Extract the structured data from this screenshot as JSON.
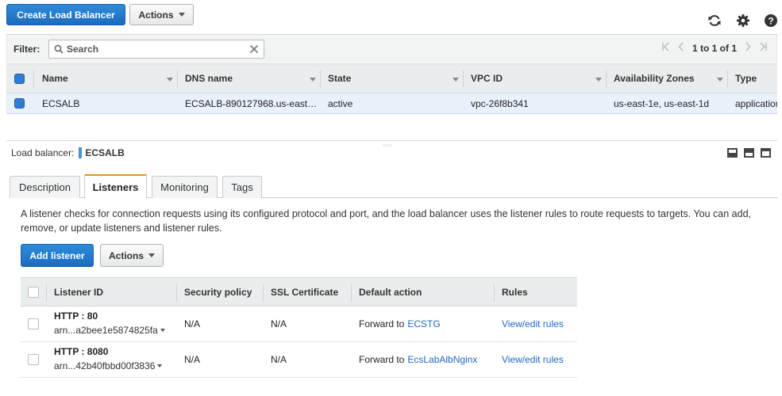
{
  "toolbar": {
    "create_button": "Create Load Balancer",
    "actions_button": "Actions",
    "icons": [
      "refresh-icon",
      "gear-icon",
      "help-icon"
    ]
  },
  "filter": {
    "label": "Filter:",
    "search_placeholder": "Search",
    "search_value": "",
    "pagination": "1 to 1 of 1"
  },
  "lb_table": {
    "columns": [
      "Name",
      "DNS name",
      "State",
      "VPC ID",
      "Availability Zones",
      "Type"
    ],
    "rows": [
      {
        "name": "ECSALB",
        "dns": "ECSALB-890127968.us-east…",
        "state": "active",
        "vpc": "vpc-26f8b341",
        "azs": "us-east-1e, us-east-1d",
        "type": "application"
      }
    ]
  },
  "details": {
    "label": "Load balancer:",
    "name": "ECSALB",
    "tabs": [
      "Description",
      "Listeners",
      "Monitoring",
      "Tags"
    ],
    "active_tab": "Listeners",
    "description": "A listener checks for connection requests using its configured protocol and port, and the load balancer uses the listener rules to route requests to targets. You can add, remove, or update listeners and listener rules.",
    "add_listener_button": "Add listener",
    "actions_button": "Actions"
  },
  "listeners": {
    "columns": [
      "Listener ID",
      "Security policy",
      "SSL Certificate",
      "Default action",
      "Rules"
    ],
    "rows": [
      {
        "protocol_port": "HTTP : 80",
        "arn": "arn...a2bee1e5874825fa",
        "security_policy": "N/A",
        "ssl_certificate": "N/A",
        "action_prefix": "Forward to",
        "target": "ECSTG",
        "rules_link": "View/edit rules"
      },
      {
        "protocol_port": "HTTP : 8080",
        "arn": "arn...42b40fbbd00f3836",
        "security_policy": "N/A",
        "ssl_certificate": "N/A",
        "action_prefix": "Forward to",
        "target": "EcsLabAlbNginx",
        "rules_link": "View/edit rules"
      }
    ]
  },
  "colors": {
    "primary": "#1b6cc0",
    "selected_row": "#e9f1fb",
    "active_tab_accent": "#e8901e",
    "link": "#1f69c0"
  }
}
